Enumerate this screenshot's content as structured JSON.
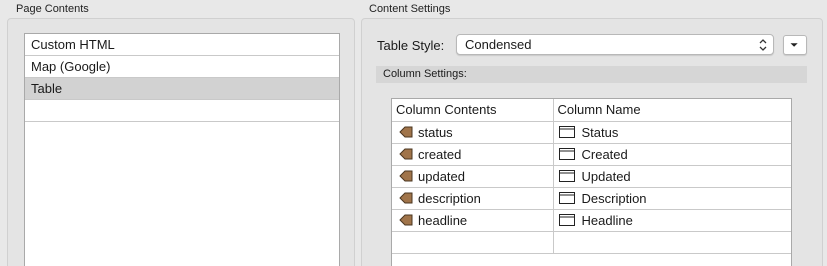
{
  "page_contents": {
    "title": "Page Contents",
    "items": [
      {
        "label": "Custom HTML"
      },
      {
        "label": "Map (Google)"
      },
      {
        "label": "Table"
      }
    ]
  },
  "content_settings": {
    "title": "Content Settings",
    "table_style_label": "Table Style:",
    "table_style_value": "Condensed",
    "column_settings_label": "Column Settings:",
    "columns_header": {
      "contents": "Column Contents",
      "name": "Column Name"
    },
    "rows": [
      {
        "contents": "status",
        "name": "Status"
      },
      {
        "contents": "created",
        "name": "Created"
      },
      {
        "contents": "updated",
        "name": "Updated"
      },
      {
        "contents": "description",
        "name": "Description"
      },
      {
        "contents": "headline",
        "name": "Headline"
      }
    ]
  },
  "colors": {
    "selected_row": "#d2d2d2",
    "arrow_icon": "#a0744a"
  }
}
